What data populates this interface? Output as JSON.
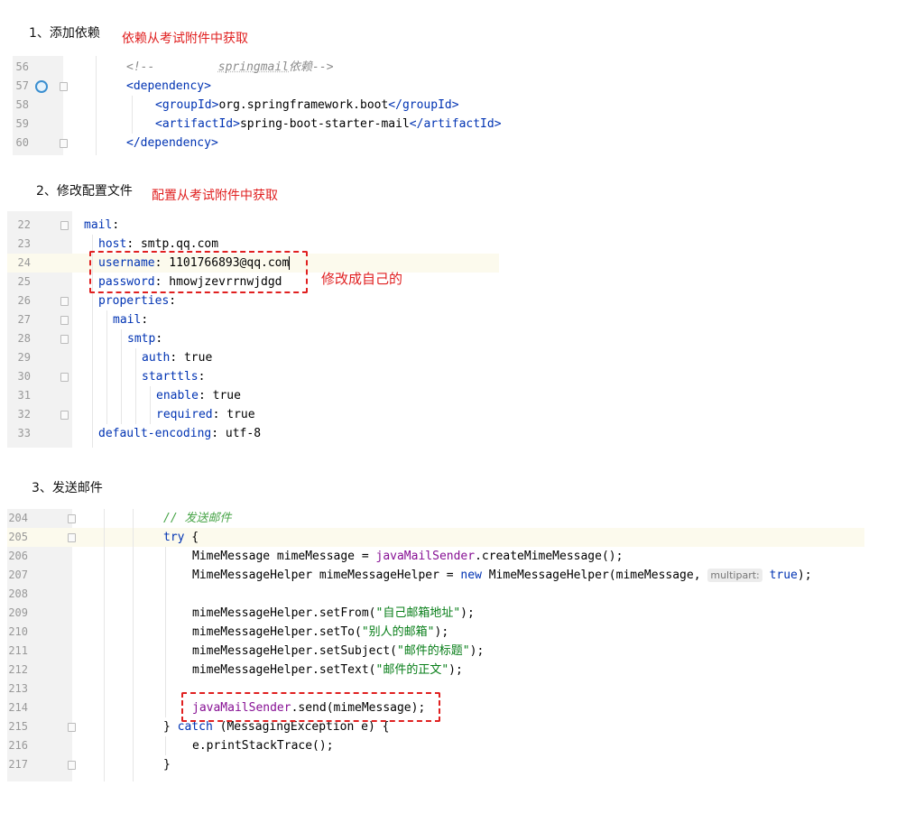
{
  "step1": {
    "heading": "1、添加依赖",
    "note": "依赖从考试附件中获取",
    "lines": [
      {
        "num": "56"
      },
      {
        "num": "57"
      },
      {
        "num": "58"
      },
      {
        "num": "59"
      },
      {
        "num": "60"
      }
    ],
    "code": {
      "c1a": "<!--",
      "c1b": "springmail",
      "c1c": "依赖-->",
      "dep_open_lt": "<",
      "dependency": "dependency",
      "gt": ">",
      "groupId": "groupId",
      "group_val": "org.springframework.boot",
      "close_lt": "</",
      "artifactId": "artifactId",
      "artifact_val": "spring-boot-starter-mail",
      "dep_close": "</"
    }
  },
  "step2": {
    "heading": "2、修改配置文件",
    "note": "配置从考试附件中获取",
    "annotation": "修改成自己的",
    "lines": [
      "22",
      "23",
      "24",
      "25",
      "26",
      "27",
      "28",
      "29",
      "30",
      "31",
      "32",
      "33"
    ],
    "yaml": {
      "mail": "mail",
      "host": "host",
      "host_val": "smtp.qq.com",
      "username": "username",
      "username_val": "1101766893@qq.com",
      "password": "password",
      "password_val": "hmowjzevrrnwjdgd",
      "properties": "properties",
      "mail2": "mail",
      "smtp": "smtp",
      "auth": "auth",
      "auth_val": "true",
      "starttls": "starttls",
      "enable": "enable",
      "enable_val": "true",
      "required": "required",
      "required_val": "true",
      "default_encoding": "default-encoding",
      "encoding_val": "utf-8",
      "colon": ":"
    }
  },
  "step3": {
    "heading": "3、发送邮件",
    "lines": [
      "204",
      "205",
      "206",
      "207",
      "208",
      "209",
      "210",
      "211",
      "212",
      "213",
      "214",
      "215",
      "216",
      "217"
    ],
    "java": {
      "comment": "// 发送邮件",
      "try": "try",
      "brace_open": " {",
      "l206a": "MimeMessage mimeMessage = ",
      "l206b": "javaMailSender",
      "l206c": ".createMimeMessage();",
      "l207a": "MimeMessageHelper mimeMessageHelper = ",
      "l207new": "new",
      "l207b": " MimeMessageHelper(mimeMessage, ",
      "l207hint": "multipart:",
      "l207true": "true",
      "l207c": ");",
      "l209a": "mimeMessageHelper.setFrom(",
      "l209s": "\"自己邮箱地址\"",
      "l210a": "mimeMessageHelper.setTo(",
      "l210s": "\"别人的邮箱\"",
      "l211a": "mimeMessageHelper.setSubject(",
      "l211s": "\"邮件的标题\"",
      "l212a": "mimeMessageHelper.setText(",
      "l212s": "\"邮件的正文\"",
      "close": ");",
      "l214a": "javaMailSender",
      "l214b": ".send(mimeMessage);",
      "l215a": "} ",
      "catch": "catch",
      "l215b": " (MessagingException e) {",
      "l216": "e.printStackTrace();",
      "l217": "}"
    }
  }
}
